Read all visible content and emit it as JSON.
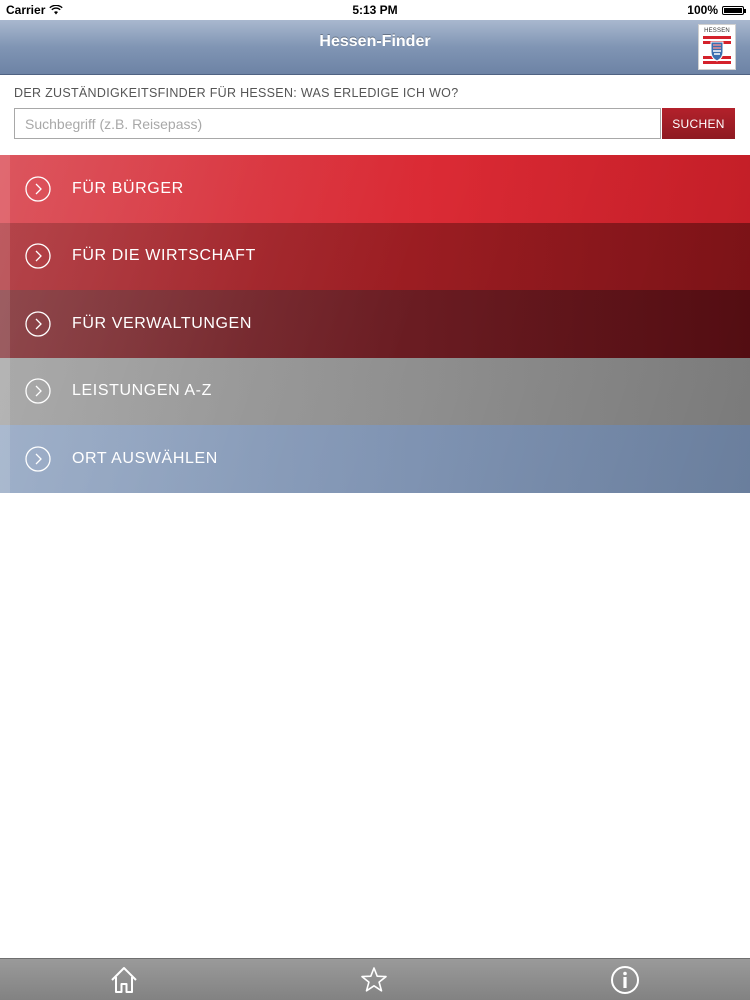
{
  "status_bar": {
    "carrier": "Carrier",
    "time": "5:13 PM",
    "battery": "100%"
  },
  "nav": {
    "title": "Hessen-Finder",
    "logo_text": "HESSEN"
  },
  "intro": {
    "text": "DER ZUSTÄNDIGKEITSFINDER FÜR HESSEN: WAS ERLEDIGE ICH WO?"
  },
  "search": {
    "placeholder": "Suchbegriff (z.B. Reisepass)",
    "value": "",
    "button_label": "SUCHEN"
  },
  "menu": {
    "items": [
      {
        "label": "FÜR BÜRGER",
        "color": "#db2a34"
      },
      {
        "label": "FÜR DIE WIRTSCHAFT",
        "color": "#9b1d22"
      },
      {
        "label": "FÜR VERWALTUNGEN",
        "color": "#6a1c22"
      },
      {
        "label": "LEISTUNGEN A-Z",
        "color": "#8f8f8f"
      },
      {
        "label": "ORT AUSWÄHLEN",
        "color": "#7f93b2"
      }
    ]
  },
  "tab_bar": {
    "tabs": [
      {
        "icon": "home-icon"
      },
      {
        "icon": "star-icon"
      },
      {
        "icon": "info-icon"
      }
    ]
  },
  "colors": {
    "accent_red": "#b3212b",
    "nav_blue": "#8095b4"
  }
}
